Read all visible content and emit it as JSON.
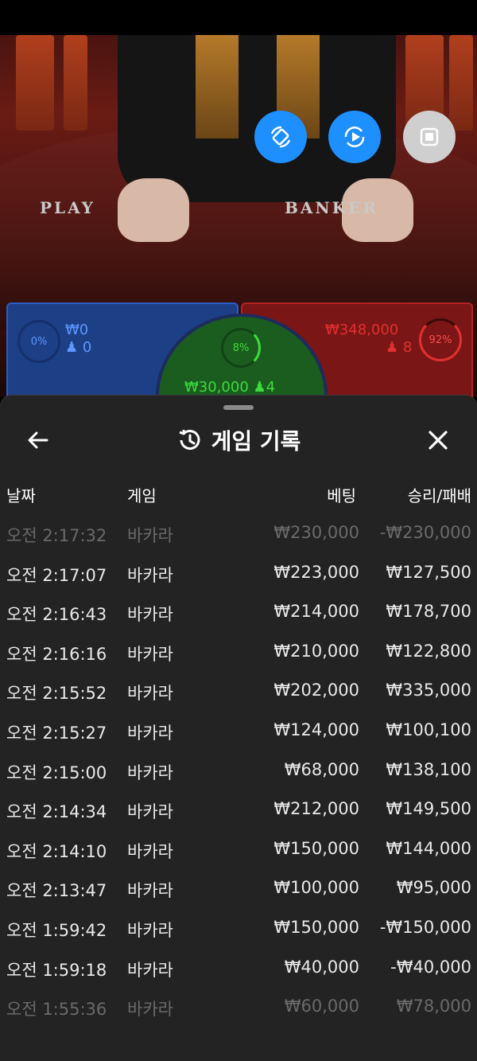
{
  "video": {
    "player_label": "PLAY",
    "banker_label": "BANKER",
    "controls": [
      {
        "name": "rotate-screen-icon",
        "color": "#1e8fff"
      },
      {
        "name": "video-sync-icon",
        "color": "#1e8fff"
      },
      {
        "name": "stop-video-icon",
        "color": "#cfcfcf"
      }
    ],
    "player": {
      "percent": "0%",
      "amount": "₩0",
      "count": "0",
      "color": "#3b7bff"
    },
    "tie": {
      "percent": "8%",
      "amount": "₩30,000",
      "count": "4",
      "color": "#3ddc3d"
    },
    "banker": {
      "percent": "92%",
      "amount": "₩348,000",
      "count": "8",
      "color": "#e23030"
    }
  },
  "sheet": {
    "back_icon": "arrow-left-icon",
    "history_icon": "history-clock-icon",
    "title": "게임 기록",
    "close_icon": "close-icon",
    "columns": {
      "date": "날짜",
      "game": "게임",
      "bet": "베팅",
      "winloss": "승리/패배"
    },
    "rows": [
      {
        "date": "오전 2:17:32",
        "game": "바카라",
        "bet": "₩230,000",
        "winloss": "-₩230,000"
      },
      {
        "date": "오전 2:17:07",
        "game": "바카라",
        "bet": "₩223,000",
        "winloss": "₩127,500"
      },
      {
        "date": "오전 2:16:43",
        "game": "바카라",
        "bet": "₩214,000",
        "winloss": "₩178,700"
      },
      {
        "date": "오전 2:16:16",
        "game": "바카라",
        "bet": "₩210,000",
        "winloss": "₩122,800"
      },
      {
        "date": "오전 2:15:52",
        "game": "바카라",
        "bet": "₩202,000",
        "winloss": "₩335,000"
      },
      {
        "date": "오전 2:15:27",
        "game": "바카라",
        "bet": "₩124,000",
        "winloss": "₩100,100"
      },
      {
        "date": "오전 2:15:00",
        "game": "바카라",
        "bet": "₩68,000",
        "winloss": "₩138,100"
      },
      {
        "date": "오전 2:14:34",
        "game": "바카라",
        "bet": "₩212,000",
        "winloss": "₩149,500"
      },
      {
        "date": "오전 2:14:10",
        "game": "바카라",
        "bet": "₩150,000",
        "winloss": "₩144,000"
      },
      {
        "date": "오전 2:13:47",
        "game": "바카라",
        "bet": "₩100,000",
        "winloss": "₩95,000"
      },
      {
        "date": "오전 1:59:42",
        "game": "바카라",
        "bet": "₩150,000",
        "winloss": "-₩150,000"
      },
      {
        "date": "오전 1:59:18",
        "game": "바카라",
        "bet": "₩40,000",
        "winloss": "-₩40,000"
      },
      {
        "date": "오전 1:55:36",
        "game": "바카라",
        "bet": "₩60,000",
        "winloss": "₩78,000"
      }
    ]
  }
}
